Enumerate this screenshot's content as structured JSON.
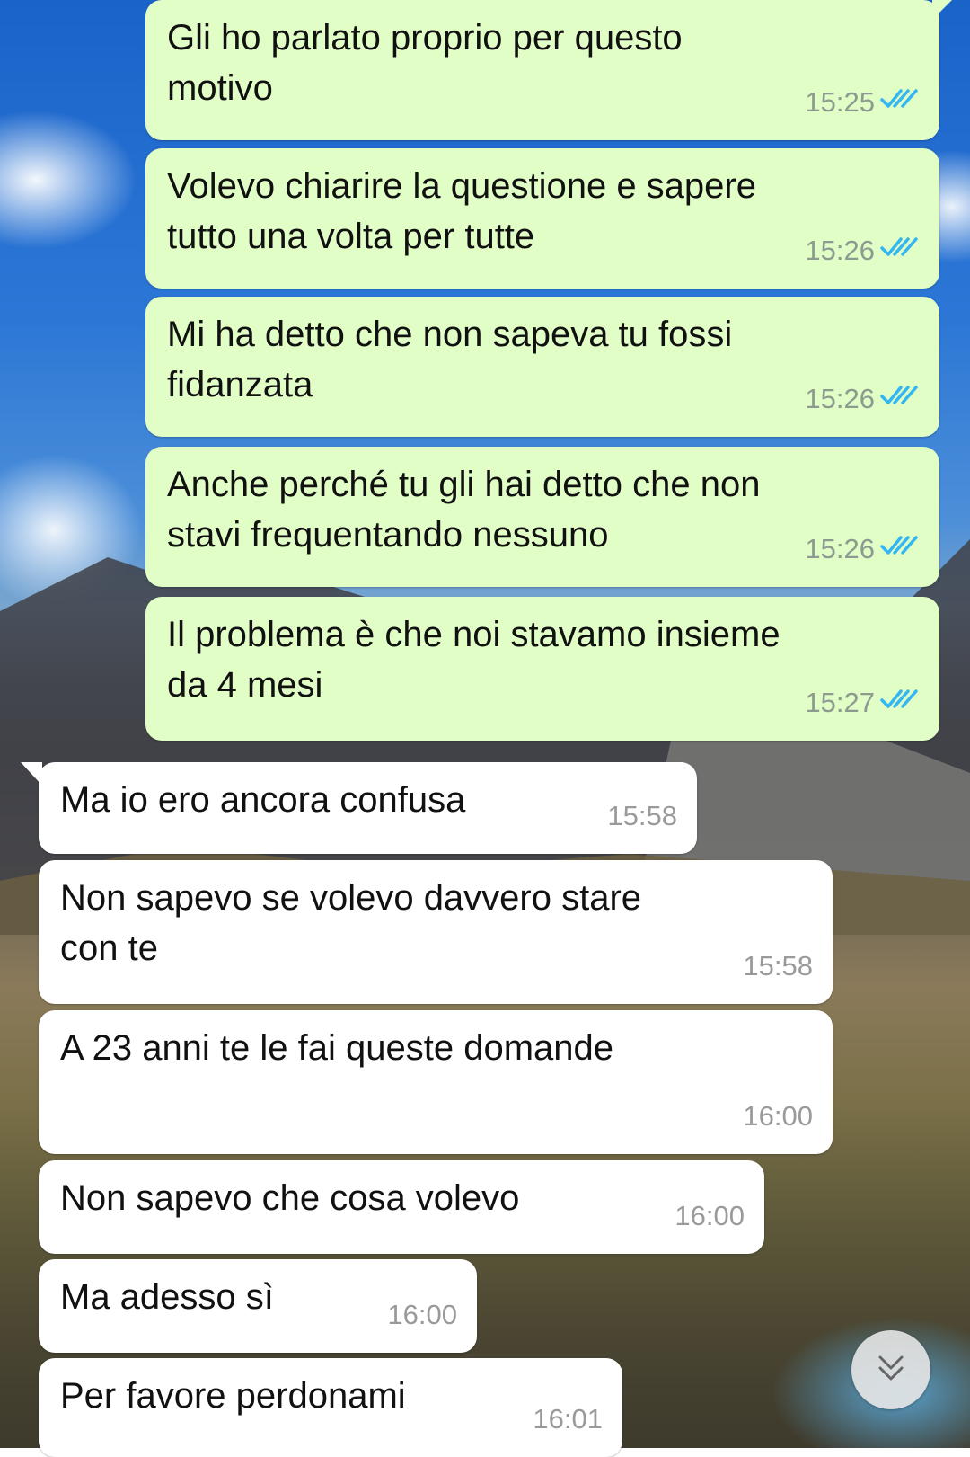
{
  "messages": [
    {
      "direction": "out",
      "text": "Gli ho parlato proprio per questo\nmotivo",
      "time": "15:25",
      "status": "read-double-check-icon"
    },
    {
      "direction": "out",
      "text": "Volevo chiarire la questione e sapere\ntutto una volta per tutte",
      "time": "15:26",
      "status": "read-double-check-icon"
    },
    {
      "direction": "out",
      "text": "Mi ha detto che non sapeva tu fossi\nfidanzata",
      "time": "15:26",
      "status": "read-double-check-icon"
    },
    {
      "direction": "out",
      "text": "Anche perché tu gli hai detto che non\nstavi frequentando nessuno",
      "time": "15:26",
      "status": "read-double-check-icon"
    },
    {
      "direction": "out",
      "text": "Il problema è che noi stavamo insieme\nda 4 mesi",
      "time": "15:27",
      "status": "read-double-check-icon"
    },
    {
      "direction": "in",
      "text": "Ma io ero ancora confusa",
      "time": "15:58"
    },
    {
      "direction": "in",
      "text": "Non sapevo se volevo davvero stare\ncon te",
      "time": "15:58"
    },
    {
      "direction": "in",
      "text": "A 23 anni te le fai queste domande",
      "time": "16:00"
    },
    {
      "direction": "in",
      "text": "Non sapevo che cosa volevo",
      "time": "16:00"
    },
    {
      "direction": "in",
      "text": "Ma adesso sì",
      "time": "16:00"
    },
    {
      "direction": "in",
      "text": "Per favore perdonami",
      "time": "16:01"
    }
  ],
  "colors": {
    "outgoing_bubble": "#e1fec6",
    "incoming_bubble": "#ffffff",
    "read_check": "#34b7f1"
  },
  "scroll_button": {
    "icon": "double-chevron-down-icon"
  }
}
